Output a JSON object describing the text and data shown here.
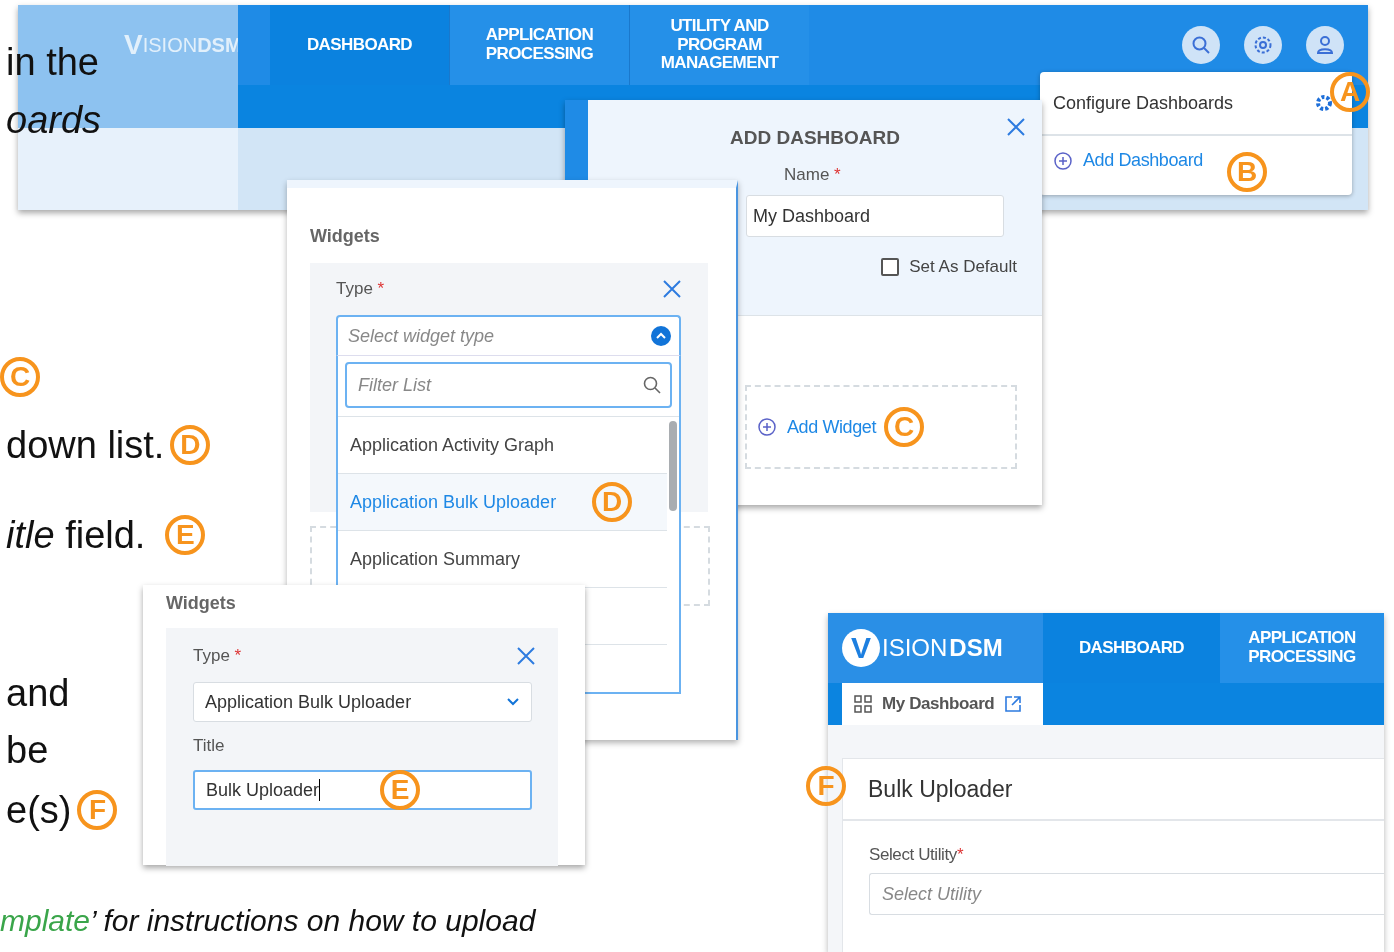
{
  "document_lines": [
    {
      "text": "in the",
      "italic": false
    },
    {
      "text": "oards",
      "italic": true
    },
    {
      "callout": "C"
    },
    {
      "text": "down list.",
      "italic": false,
      "callout": "D"
    },
    {
      "text": "*itle* field.",
      "italic": false,
      "callout": "E"
    },
    {
      "text": "and",
      "italic": false
    },
    {
      "text": "be",
      "italic": false
    },
    {
      "text": "e(s)",
      "italic": false,
      "callout": "F"
    }
  ],
  "document_bottom_line": {
    "link_text": "mplate",
    "text": "’ for instructions on how to upload"
  },
  "top_screenshot": {
    "logo": {
      "initial": "V",
      "name": "ISION",
      "suffix": "DSM"
    },
    "nav_tabs": [
      {
        "label": "DASHBOARD",
        "selected": true
      },
      {
        "label": "APPLICATION PROCESSING",
        "selected": false
      },
      {
        "label": "UTILITY AND PROGRAM MANAGEMENT",
        "selected": false
      }
    ],
    "menu": {
      "title": "Configure Dashboards",
      "action": "Add Dashboard"
    },
    "callouts": [
      "A",
      "B"
    ]
  },
  "add_dashboard_dialog": {
    "title": "ADD DASHBOARD",
    "name_label": "Name",
    "required_mark": "*",
    "name_value": "My Dashboard",
    "set_default": {
      "label": "Set As Default",
      "checked": false
    },
    "add_widget": "Add Widget",
    "callout": "C"
  },
  "widgets_panel_open": {
    "heading": "Widgets",
    "type_label": "Type",
    "required_mark": "*",
    "placeholder": "Select widget type",
    "filter_placeholder": "Filter List",
    "options": [
      {
        "label": "Application Activity Graph",
        "selected": false
      },
      {
        "label": "Application Bulk Uploader",
        "selected": true
      },
      {
        "label": "Application Summary",
        "selected": false
      }
    ],
    "callout": "D"
  },
  "widgets_panel_filled": {
    "heading": "Widgets",
    "type_label": "Type",
    "required_mark": "*",
    "type_value": "Application Bulk Uploader",
    "title_label": "Title",
    "title_value": "Bulk Uploader",
    "callout": "E"
  },
  "bottom_screenshot": {
    "logo": {
      "initial": "V",
      "name": "ISION",
      "suffix": "DSM"
    },
    "nav_tabs": [
      {
        "label": "DASHBOARD",
        "selected": true
      },
      {
        "label": "APPLICATION PROCESSING",
        "selected": false
      }
    ],
    "subtab": "My Dashboard",
    "card_title": "Bulk Uploader",
    "callout": "F",
    "field_label": "Select Utility",
    "required_mark": "*",
    "field_placeholder": "Select Utility"
  }
}
